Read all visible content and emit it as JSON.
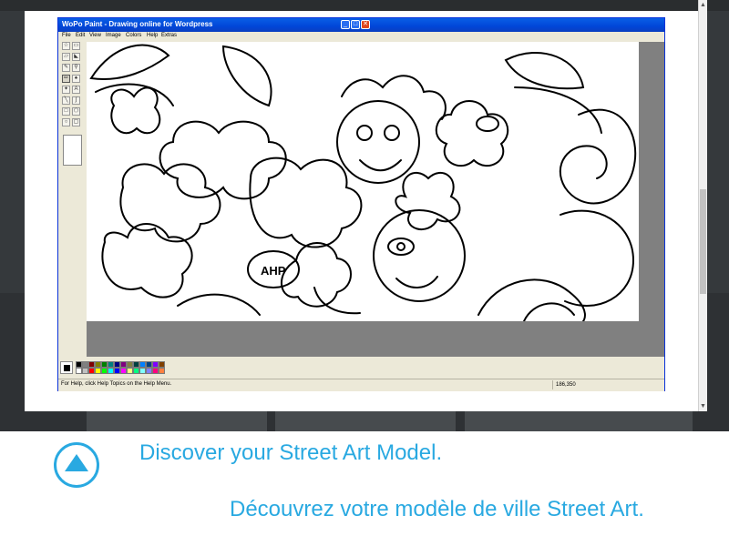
{
  "window": {
    "title": "WoPo Paint - Drawing online for Wordpress",
    "min_glyph": "_",
    "max_glyph": "□",
    "close_glyph": "✕"
  },
  "menu": [
    "File",
    "Edit",
    "View",
    "Image",
    "Colors",
    "Help",
    "Extras"
  ],
  "tools": [
    {
      "name": "free-select-tool",
      "glyph": "☆"
    },
    {
      "name": "select-tool",
      "glyph": "▭"
    },
    {
      "name": "eraser-tool",
      "glyph": "▱"
    },
    {
      "name": "fill-tool",
      "glyph": "◣"
    },
    {
      "name": "color-picker-tool",
      "glyph": "✎"
    },
    {
      "name": "magnifier-tool",
      "glyph": "⚲"
    },
    {
      "name": "pencil-tool",
      "glyph": "✏"
    },
    {
      "name": "brush-tool",
      "glyph": "♠"
    },
    {
      "name": "airbrush-tool",
      "glyph": "✦"
    },
    {
      "name": "text-tool",
      "glyph": "A"
    },
    {
      "name": "line-tool",
      "glyph": "╲"
    },
    {
      "name": "curve-tool",
      "glyph": "∫"
    },
    {
      "name": "rectangle-tool",
      "glyph": "□"
    },
    {
      "name": "polygon-tool",
      "glyph": "⬠"
    },
    {
      "name": "ellipse-tool",
      "glyph": "○"
    },
    {
      "name": "rounded-rectangle-tool",
      "glyph": "▢"
    }
  ],
  "selected_tool": "pencil-tool",
  "palette": {
    "foreground": "#000000",
    "background": "#ffffff",
    "colors": [
      "#000000",
      "#808080",
      "#800000",
      "#808000",
      "#008000",
      "#008080",
      "#000080",
      "#800080",
      "#808040",
      "#004040",
      "#0080ff",
      "#004080",
      "#8000ff",
      "#804000",
      "#ffffff",
      "#c0c0c0",
      "#ff0000",
      "#ffff00",
      "#00ff00",
      "#00ffff",
      "#0000ff",
      "#ff00ff",
      "#ffff80",
      "#00ff80",
      "#80ffff",
      "#8080ff",
      "#ff0080",
      "#ff8040"
    ]
  },
  "status": {
    "help": "For Help, click Help Topics on the Help Menu.",
    "coords": "186,350"
  },
  "caption": {
    "english": "Discover your Street Art Model.",
    "french": "Découvrez votre modèle de ville Street Art."
  },
  "colors": {
    "accent": "#29a9e1",
    "titlebar": "#0146d8",
    "chrome": "#ece9d8"
  }
}
